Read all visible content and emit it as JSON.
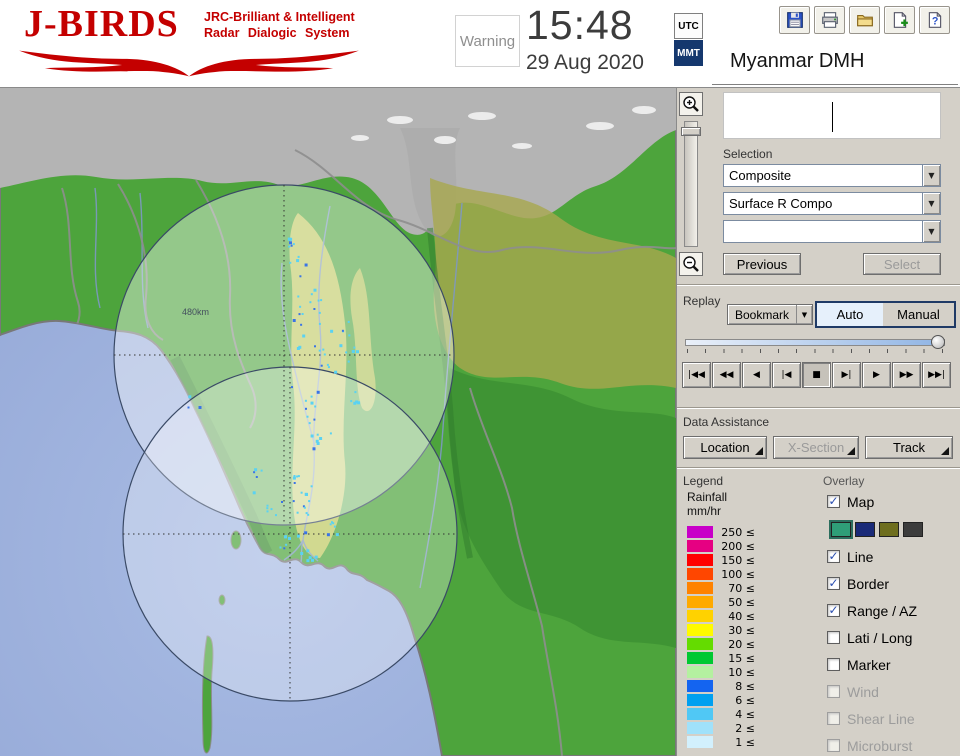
{
  "header": {
    "logo": {
      "title": "J-BIRDS",
      "subtitle_line1": "JRC-Brilliant & Intelligent",
      "subtitle_line2": "Radar Dialogic System"
    },
    "warning_label": "Warning",
    "clock": {
      "time": "15:48",
      "date": "29 Aug 2020"
    },
    "timezone": {
      "utc": "UTC",
      "mmt": "MMT",
      "selected": "MMT"
    },
    "station": "Myanmar DMH"
  },
  "map": {
    "range_label": "480km"
  },
  "panel": {
    "selection": {
      "label": "Selection",
      "combo_primary": "Composite",
      "combo_secondary": "Surface R Compo",
      "combo_tertiary": "",
      "previous_label": "Previous",
      "select_label": "Select"
    },
    "replay": {
      "label": "Replay",
      "bookmark_label": "Bookmark",
      "auto_label": "Auto",
      "manual_label": "Manual",
      "active_index": 4,
      "transport": [
        "|◀◀",
        "◀◀",
        "◀",
        "|◀",
        "■",
        "▶|",
        "▶",
        "▶▶",
        "▶▶|"
      ]
    },
    "data_assistance": {
      "label": "Data Assistance",
      "location_label": "Location",
      "xsection_label": "X-Section",
      "track_label": "Track"
    },
    "legend": {
      "label": "Legend",
      "unit_line1": "Rainfall",
      "unit_line2": "mm/hr",
      "suffix": "≤",
      "entries": [
        {
          "value": "250",
          "color": "#c800c8"
        },
        {
          "value": "200",
          "color": "#e60082"
        },
        {
          "value": "150",
          "color": "#ff0000"
        },
        {
          "value": "100",
          "color": "#ff4600"
        },
        {
          "value": "70",
          "color": "#ff8200"
        },
        {
          "value": "50",
          "color": "#ffaa00"
        },
        {
          "value": "40",
          "color": "#ffd200"
        },
        {
          "value": "30",
          "color": "#fffa00"
        },
        {
          "value": "20",
          "color": "#64dc00"
        },
        {
          "value": "15",
          "color": "#00c832"
        },
        {
          "value": "10",
          "color": "#b4f0a0"
        },
        {
          "value": "8",
          "color": "#1464f0"
        },
        {
          "value": "6",
          "color": "#00a0f0"
        },
        {
          "value": "4",
          "color": "#50c8f5"
        },
        {
          "value": "2",
          "color": "#a0e1fa"
        },
        {
          "value": "1",
          "color": "#d2f0fd"
        }
      ]
    },
    "overlay": {
      "label": "Overlay",
      "selected_style": 0,
      "map_styles": [
        "#2f9e78",
        "#1a2a78",
        "#6e6e1e",
        "#3c3c3c"
      ],
      "items": [
        {
          "label": "Map",
          "checked": true,
          "enabled": true
        },
        {
          "label": "Line",
          "checked": true,
          "enabled": true
        },
        {
          "label": "Border",
          "checked": true,
          "enabled": true
        },
        {
          "label": "Range / AZ",
          "checked": true,
          "enabled": true
        },
        {
          "label": "Lati / Long",
          "checked": false,
          "enabled": true
        },
        {
          "label": "Marker",
          "checked": false,
          "enabled": true
        },
        {
          "label": "Wind",
          "checked": false,
          "enabled": false
        },
        {
          "label": "Shear Line",
          "checked": false,
          "enabled": false
        },
        {
          "label": "Microburst",
          "checked": false,
          "enabled": false
        }
      ]
    }
  }
}
